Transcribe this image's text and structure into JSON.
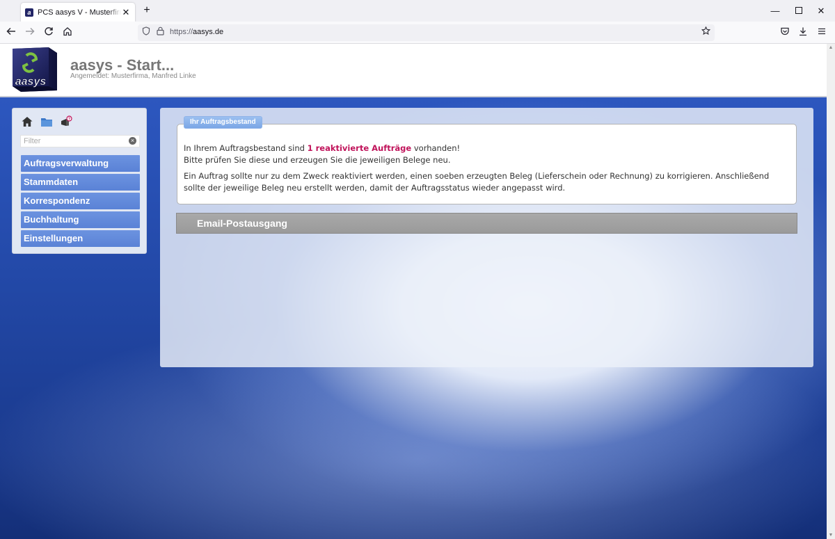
{
  "browser": {
    "tab_title": "PCS aasys V - Musterfirma - Manfred Linke",
    "tab_favicon_text": "a",
    "new_tab": "+",
    "url_prefix": "https://",
    "url_host": "aasys.de"
  },
  "header": {
    "title": "aasys - Start...",
    "subtitle": "Angemeldet: Musterfirma, Manfred Linke",
    "logo_text": "aasys"
  },
  "sidebar": {
    "filter_placeholder": "Filter",
    "menu": [
      {
        "label": "Auftragsverwaltung"
      },
      {
        "label": "Stammdaten"
      },
      {
        "label": "Korrespondenz"
      },
      {
        "label": "Buchhaltung"
      },
      {
        "label": "Einstellungen"
      }
    ]
  },
  "auftragsbestand": {
    "legend": "Ihr Auftragsbestand",
    "line1_pre": "In Ihrem Auftragsbestand sind ",
    "line1_highlight": "1 reaktivierte Aufträge",
    "line1_post": " vorhanden!",
    "line2": "Bitte prüfen Sie diese und erzeugen Sie die jeweiligen Belege neu.",
    "paragraph": "Ein Auftrag sollte nur zu dem Zweck reaktiviert werden, einen soeben erzeugten Beleg (Lieferschein oder Rechnung) zu korrigieren. Anschließend sollte der jeweilige Beleg neu erstellt werden, damit der Auftragsstatus wieder angepasst wird."
  },
  "email_section": {
    "title": "Email-Postausgang"
  },
  "colors": {
    "menu_bg": "#6188da",
    "highlight": "#c0135a",
    "legend_bg": "#88b0ea"
  }
}
